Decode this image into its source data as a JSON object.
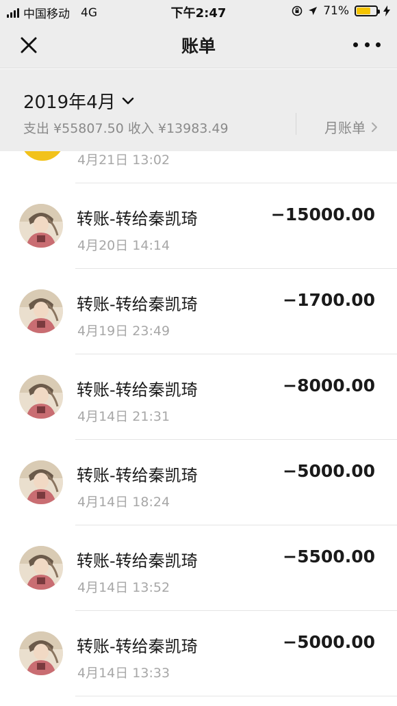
{
  "status_bar": {
    "carrier": "中国移动",
    "network": "4G",
    "time": "下午2:47",
    "battery_text": "71%",
    "battery_level": 0.71,
    "battery_color": "#f5c400"
  },
  "nav": {
    "title": "账单",
    "close_icon": "close-icon",
    "more_icon": "more-icon"
  },
  "month_header": {
    "month": "2019年4月",
    "summary": "支出 ¥55807.50 收入 ¥13983.49",
    "bill_link": "月账单"
  },
  "partial_item": {
    "date": "4月21日 13:02",
    "avatar_color": "#f2c21b"
  },
  "transactions": [
    {
      "title": "转账-转给秦凯琦",
      "date": "4月20日 14:14",
      "amount": "−15000.00"
    },
    {
      "title": "转账-转给秦凯琦",
      "date": "4月19日 23:49",
      "amount": "−1700.00"
    },
    {
      "title": "转账-转给秦凯琦",
      "date": "4月14日 21:31",
      "amount": "−8000.00"
    },
    {
      "title": "转账-转给秦凯琦",
      "date": "4月14日 18:24",
      "amount": "−5000.00"
    },
    {
      "title": "转账-转给秦凯琦",
      "date": "4月14日 13:52",
      "amount": "−5500.00"
    },
    {
      "title": "转账-转给秦凯琦",
      "date": "4月14日 13:33",
      "amount": "−5000.00"
    }
  ]
}
